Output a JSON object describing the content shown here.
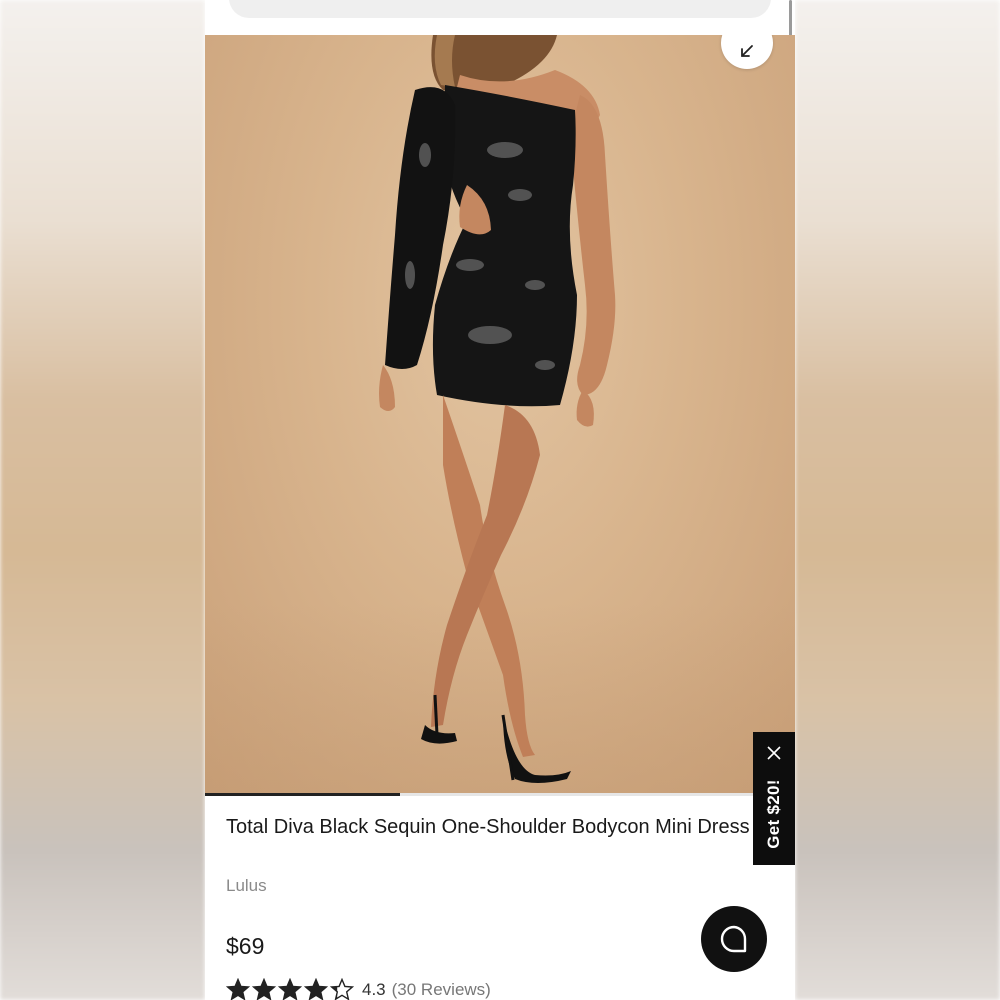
{
  "product": {
    "title": "Total Diva Black Sequin One-Shoulder Bodycon Mini Dress",
    "brand": "Lulus",
    "price": "$69",
    "rating": "4.3",
    "rating_value": 4.3,
    "rating_max": 5,
    "reviews": "(30 Reviews)"
  },
  "gallery": {
    "progress": 0.33,
    "expand_icon": "expand-arrow-icon"
  },
  "promo": {
    "label": "Get $20!",
    "close_icon": "close-icon"
  },
  "chat": {
    "icon": "chat-bubble-icon"
  },
  "colors": {
    "accent": "#0d0d0d",
    "text": "#1a1a1a",
    "muted": "#8a8a8a",
    "photo_bg": "#d8b48d"
  }
}
